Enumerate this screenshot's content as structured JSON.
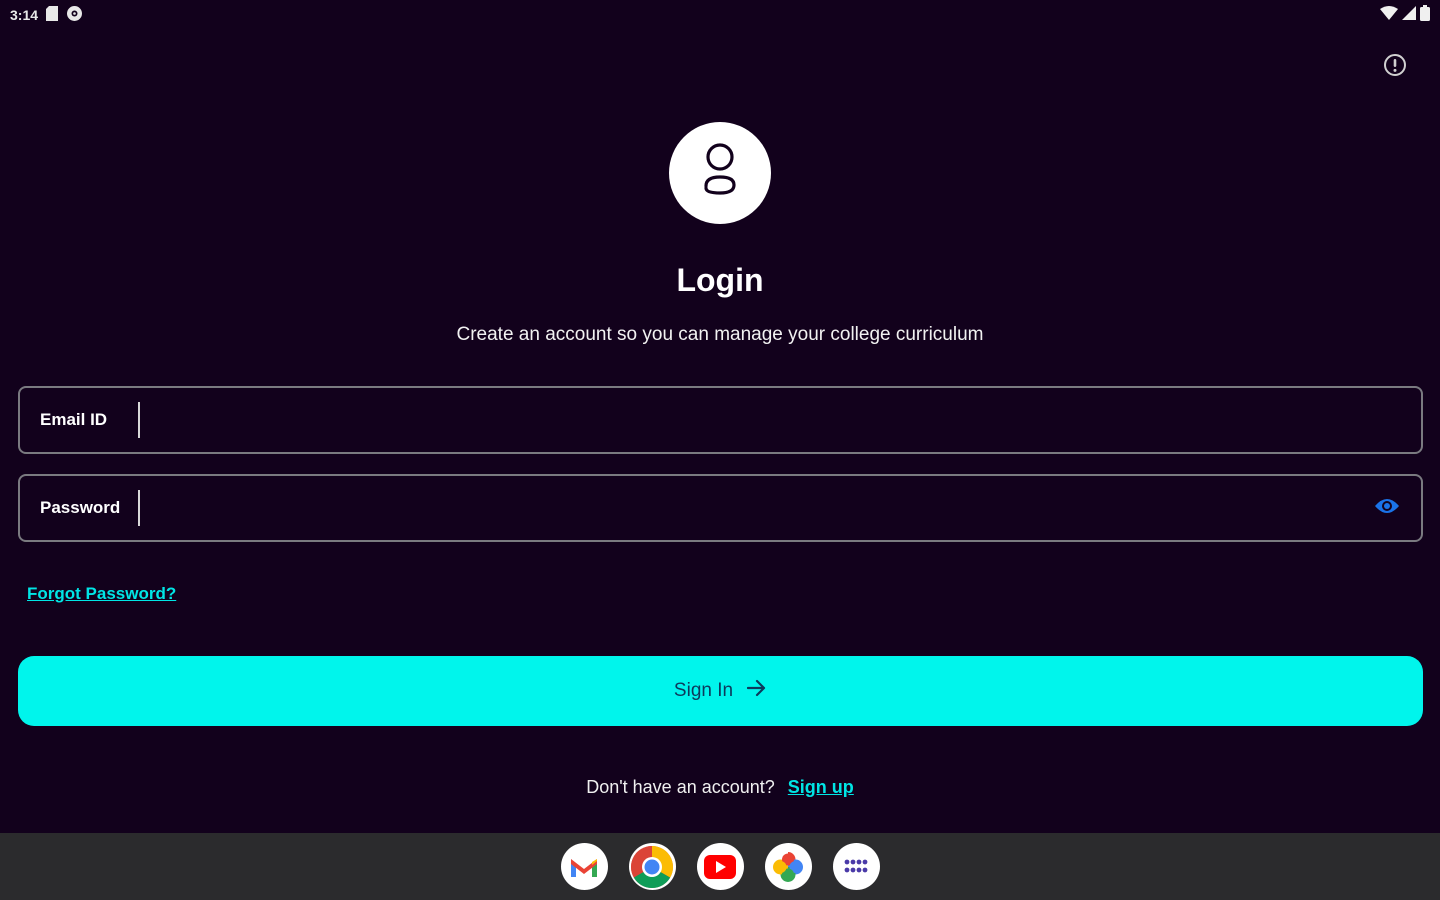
{
  "status_bar": {
    "time": "3:14",
    "left_icons": [
      "sd-card-icon",
      "settings-status-icon"
    ],
    "right_icons": [
      "wifi-icon",
      "cellular-icon",
      "battery-icon"
    ]
  },
  "top_action_icon": "info-circle-icon",
  "header": {
    "avatar_icon": "person-icon",
    "title": "Login",
    "subtitle": "Create an account so you can manage your college curriculum"
  },
  "form": {
    "email": {
      "label": "Email ID",
      "value": ""
    },
    "password": {
      "label": "Password",
      "value": "",
      "toggle_icon": "eye-icon"
    },
    "forgot_password": "Forgot Password?",
    "submit_label": "Sign In",
    "submit_icon": "arrow-right-icon"
  },
  "signup": {
    "prompt": "Don't have an account?",
    "link": "Sign up"
  },
  "dock": {
    "apps": [
      "gmail-icon",
      "chrome-icon",
      "youtube-icon",
      "photos-icon",
      "app-drawer-icon"
    ]
  },
  "colors": {
    "background": "#12011c",
    "accent": "#00f5ec",
    "link": "#00e5e5",
    "eye_icon": "#1a73e8",
    "dock": "#2b2b2d"
  }
}
